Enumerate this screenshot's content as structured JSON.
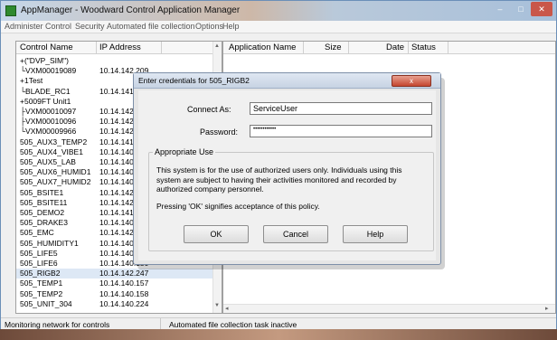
{
  "window": {
    "title": "AppManager - Woodward Control Application Manager",
    "controls": {
      "minimize": "–",
      "maximize": "□",
      "close": "✕"
    }
  },
  "menu": [
    "Administer",
    "Control",
    "Security",
    "Automated file collection",
    "Options",
    "Help"
  ],
  "controls_list": {
    "columns": [
      "Control Name",
      "IP Address"
    ],
    "rows": [
      {
        "name": "+(\"DVP_SIM\")",
        "ip": ""
      },
      {
        "name": "└VXM00019089",
        "ip": "10.14.142.209"
      },
      {
        "name": "+1Test",
        "ip": ""
      },
      {
        "name": "└BLADE_RC1",
        "ip": "10.14.141."
      },
      {
        "name": "+5009FT Unit1",
        "ip": ""
      },
      {
        "name": "├VXM00010097",
        "ip": "10.14.142."
      },
      {
        "name": "├VXM00010096",
        "ip": "10.14.142."
      },
      {
        "name": "└VXM00009966",
        "ip": "10.14.142."
      },
      {
        "name": "505_AUX3_TEMP2",
        "ip": "10.14.141."
      },
      {
        "name": "505_AUX4_VIBE1",
        "ip": "10.14.140."
      },
      {
        "name": "505_AUX5_LAB",
        "ip": "10.14.140."
      },
      {
        "name": "505_AUX6_HUMID1",
        "ip": "10.14.140."
      },
      {
        "name": "505_AUX7_HUMID2",
        "ip": "10.14.140."
      },
      {
        "name": "505_BSITE1",
        "ip": "10.14.142."
      },
      {
        "name": "505_BSITE11",
        "ip": "10.14.142."
      },
      {
        "name": "505_DEMO2",
        "ip": "10.14.141."
      },
      {
        "name": "505_DRAKE3",
        "ip": "10.14.140."
      },
      {
        "name": "505_EMC",
        "ip": "10.14.142."
      },
      {
        "name": "505_HUMIDITY1",
        "ip": "10.14.140."
      },
      {
        "name": "505_LIFE5",
        "ip": "10.14.140."
      },
      {
        "name": "505_LIFE6",
        "ip": "10.14.140.150"
      },
      {
        "name": "505_RIGB2",
        "ip": "10.14.142.247",
        "selected": true
      },
      {
        "name": "505_TEMP1",
        "ip": "10.14.140.157"
      },
      {
        "name": "505_TEMP2",
        "ip": "10.14.140.158"
      },
      {
        "name": "505_UNIT_304",
        "ip": "10.14.140.224"
      }
    ]
  },
  "applications": {
    "columns": [
      "Application Name",
      "Size",
      "Date",
      "Status"
    ]
  },
  "status": {
    "left": "Monitoring network for controls",
    "right": "Automated file collection task inactive"
  },
  "dialog": {
    "title": "Enter credentials for 505_RIGB2",
    "close": "x",
    "connect_as_label": "Connect As:",
    "connect_as_value": "ServiceUser",
    "password_label": "Password:",
    "password_value": "••••••••••••",
    "group_title": "Appropriate Use",
    "policy_text": "This system is for the use of authorized users only. Individuals using this system are subject to having their activities monitored and recorded by authorized company personnel.",
    "policy_note": "Pressing 'OK' signifies acceptance of this policy.",
    "ok": "OK",
    "cancel": "Cancel",
    "help": "Help"
  }
}
